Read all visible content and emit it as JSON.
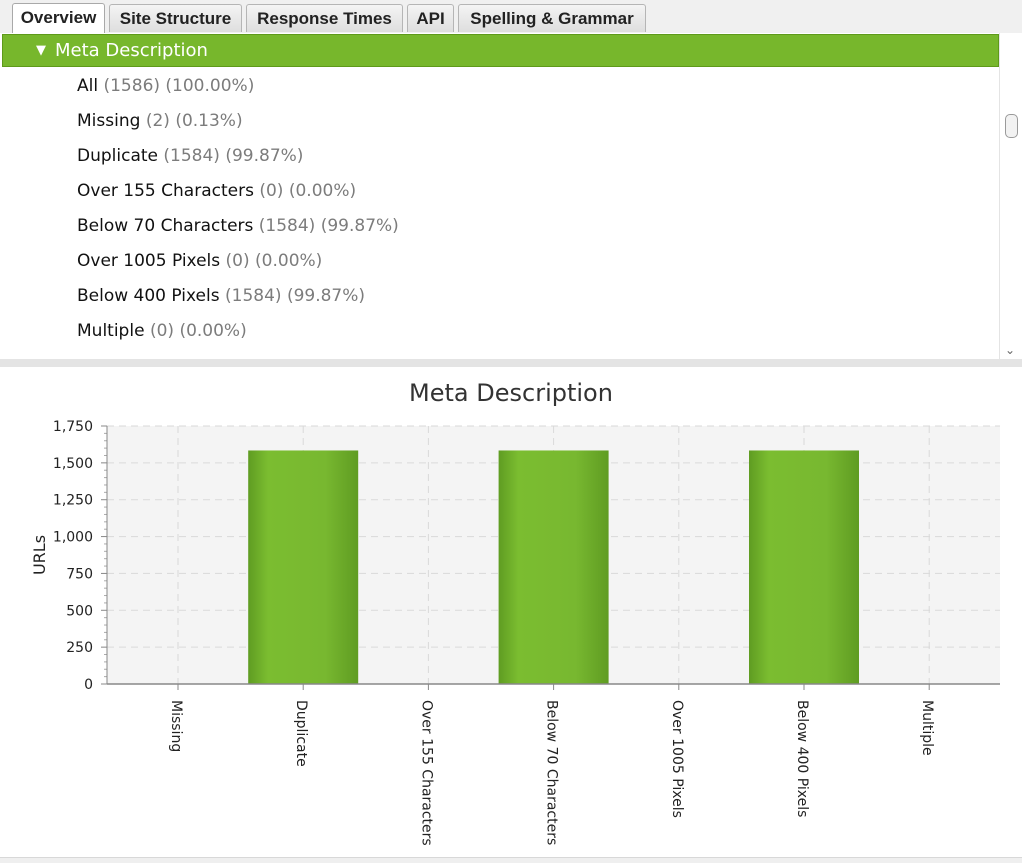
{
  "tabs": [
    {
      "label": "Overview",
      "active": true
    },
    {
      "label": "Site Structure",
      "active": false
    },
    {
      "label": "Response Times",
      "active": false
    },
    {
      "label": "API",
      "active": false
    },
    {
      "label": "Spelling & Grammar",
      "active": false
    }
  ],
  "tree": {
    "header": "Meta Description",
    "rows": [
      {
        "name": "All",
        "count": "(1586)",
        "pct": "(100.00%)"
      },
      {
        "name": "Missing",
        "count": "(2)",
        "pct": "(0.13%)"
      },
      {
        "name": "Duplicate",
        "count": "(1584)",
        "pct": "(99.87%)"
      },
      {
        "name": "Over 155 Characters",
        "count": "(0)",
        "pct": "(0.00%)"
      },
      {
        "name": "Below 70 Characters",
        "count": "(1584)",
        "pct": "(99.87%)"
      },
      {
        "name": "Over 1005 Pixels",
        "count": "(0)",
        "pct": "(0.00%)"
      },
      {
        "name": "Below 400 Pixels",
        "count": "(1584)",
        "pct": "(99.87%)"
      },
      {
        "name": "Multiple",
        "count": "(0)",
        "pct": "(0.00%)"
      }
    ]
  },
  "colors": {
    "accent": "#77b72c",
    "bar": "#74b42d",
    "plot_bg": "#f4f4f4"
  },
  "chart_data": {
    "type": "bar",
    "title": "Meta Description",
    "xlabel": "",
    "ylabel": "URLs",
    "categories": [
      "Missing",
      "Duplicate",
      "Over 155 Characters",
      "Below 70 Characters",
      "Over 1005 Pixels",
      "Below 400 Pixels",
      "Multiple"
    ],
    "values": [
      2,
      1584,
      0,
      1584,
      0,
      1584,
      0
    ],
    "ylim": [
      0,
      1750
    ],
    "yticks": [
      0,
      250,
      500,
      750,
      1000,
      1250,
      1500,
      1750
    ],
    "ytick_labels": [
      "0",
      "250",
      "500",
      "750",
      "1,000",
      "1,250",
      "1,500",
      "1,750"
    ],
    "grid": true
  }
}
